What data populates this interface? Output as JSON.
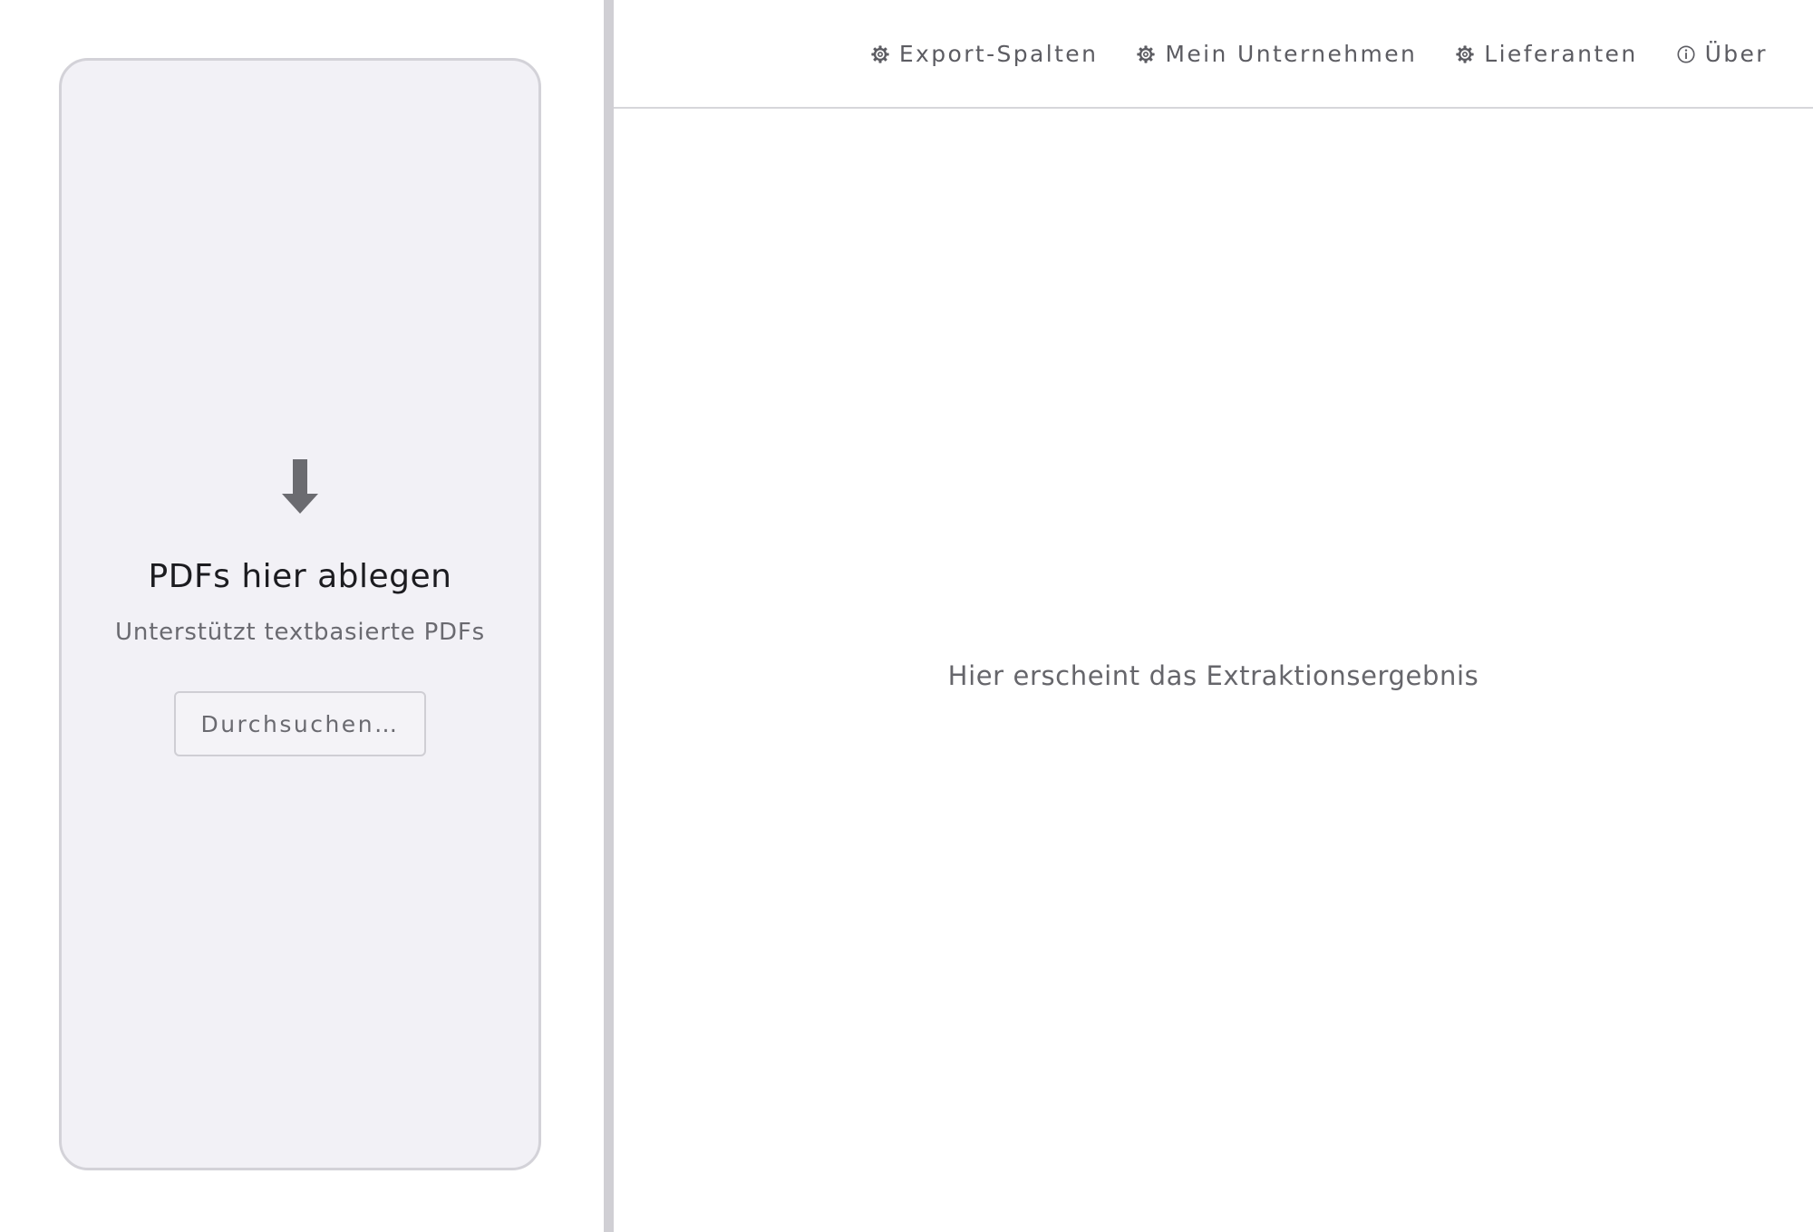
{
  "dropzone": {
    "icon": "arrow-down-icon",
    "title": "PDFs hier ablegen",
    "subtitle": "Unterstützt textbasierte PDFs",
    "browse_label": "Durchsuchen…"
  },
  "toolbar": {
    "items": [
      {
        "label": "Export-Spalten",
        "icon": "gear-icon"
      },
      {
        "label": "Mein Unternehmen",
        "icon": "gear-icon"
      },
      {
        "label": "Lieferanten",
        "icon": "gear-icon"
      },
      {
        "label": "Über",
        "icon": "info-icon"
      }
    ]
  },
  "result": {
    "placeholder": "Hier erscheint das Extraktionsergebnis"
  },
  "colors": {
    "dropzone_bg": "#f2f1f6",
    "dropzone_border": "#d3d2d8",
    "divider": "#d0cfd4",
    "icon": "#6b6b70"
  }
}
